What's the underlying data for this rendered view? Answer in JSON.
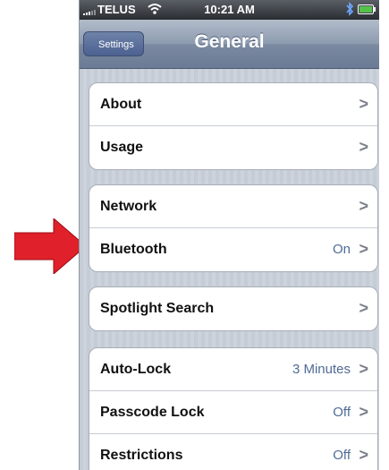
{
  "status_bar": {
    "carrier": "TELUS",
    "time": "10:21 AM"
  },
  "nav_bar": {
    "back_label": "Settings",
    "title": "General"
  },
  "groups": [
    {
      "cells": [
        {
          "label": "About",
          "value": ""
        },
        {
          "label": "Usage",
          "value": ""
        }
      ]
    },
    {
      "cells": [
        {
          "label": "Network",
          "value": ""
        },
        {
          "label": "Bluetooth",
          "value": "On"
        }
      ]
    },
    {
      "cells": [
        {
          "label": "Spotlight Search",
          "value": ""
        }
      ]
    },
    {
      "cells": [
        {
          "label": "Auto-Lock",
          "value": "3 Minutes"
        },
        {
          "label": "Passcode Lock",
          "value": "Off"
        },
        {
          "label": "Restrictions",
          "value": "Off"
        }
      ]
    }
  ],
  "chevron_glyph": ">",
  "colors": {
    "annotation_arrow": "#e0202a",
    "nav_bar": "#8d9bb0",
    "value_text": "#4f6b95"
  }
}
